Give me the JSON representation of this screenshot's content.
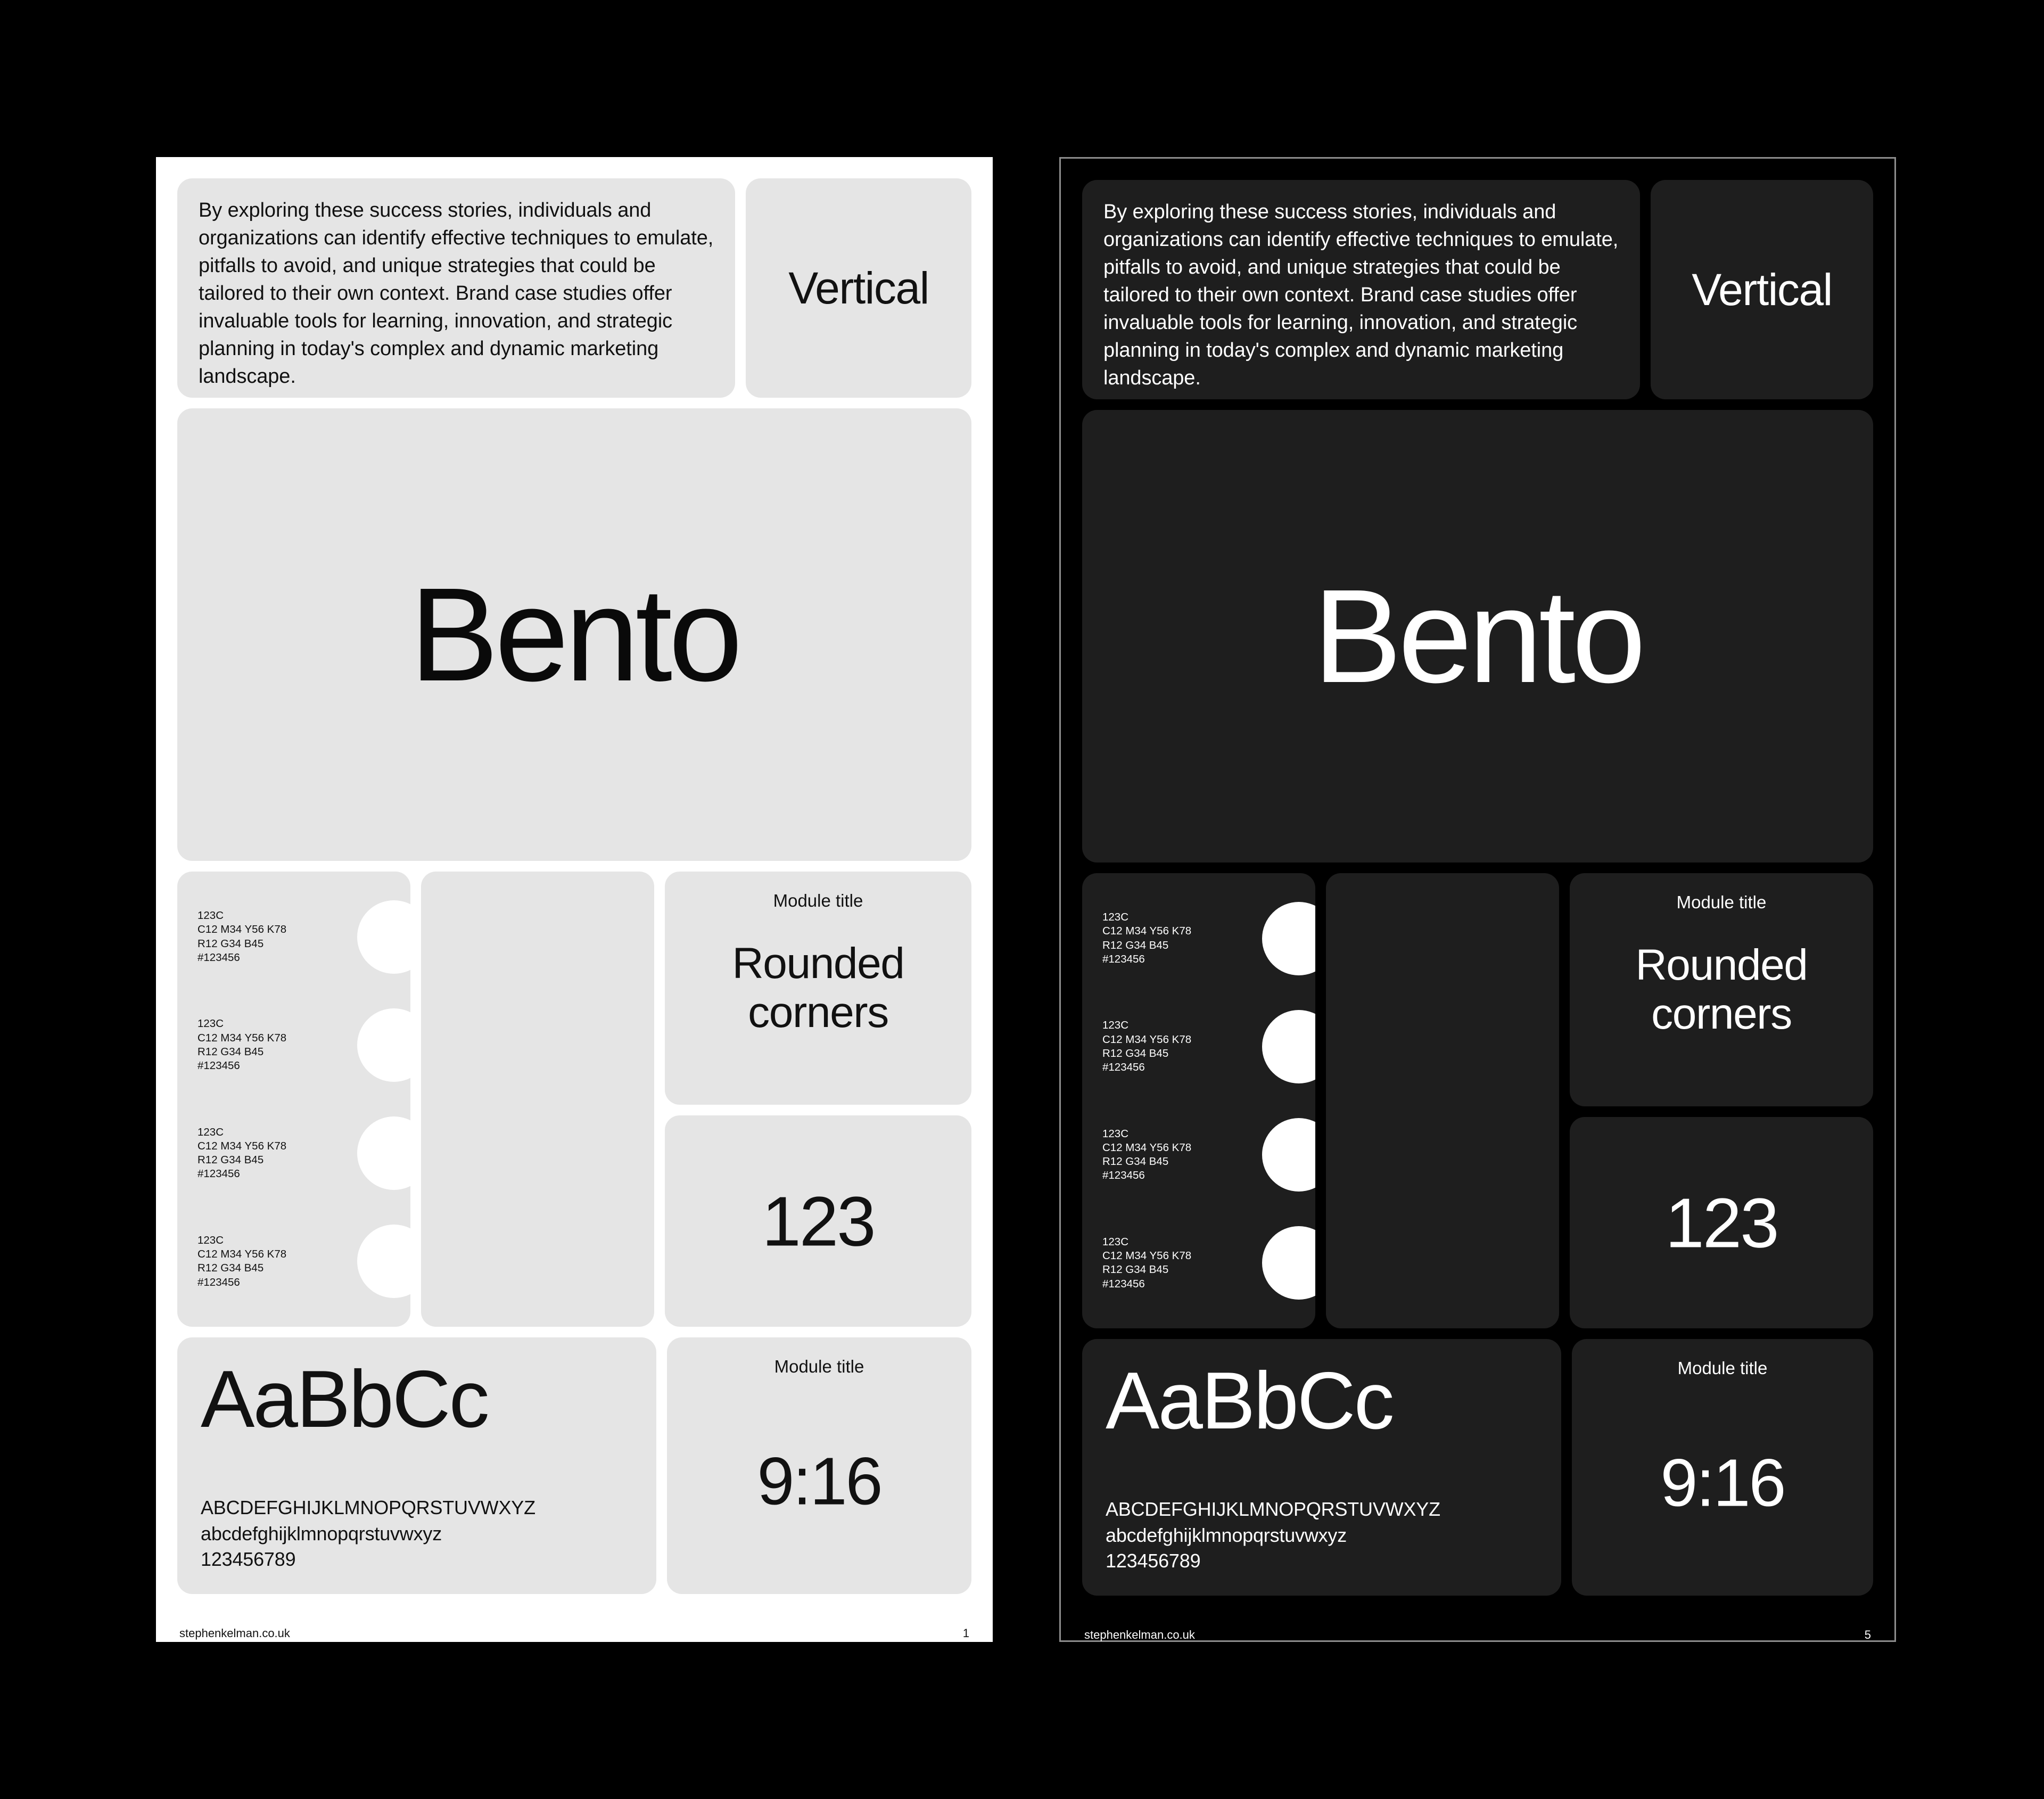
{
  "theme": {
    "canvas_background": "#000000",
    "light_poster_background": "#ffffff",
    "dark_poster_background": "#000000",
    "light_module_background": "#e5e5e5",
    "dark_module_background": "#1e1e1e",
    "light_text": "#111111",
    "dark_text": "#ffffff",
    "dark_poster_border": "#8d8d8d",
    "swatch_dot_color": "#ffffff"
  },
  "content": {
    "body_copy": "By exploring these success stories, individuals and organizations can identify effective techniques to emulate, pitfalls to avoid, and unique strategies that could be tailored to their own context. Brand case studies offer invaluable tools for learning, innovation, and strategic planning in today's complex and dynamic marketing landscape.",
    "vertical_label": "Vertical",
    "hero_word": "Bento",
    "rounded_module": {
      "title": "Module title",
      "headline": "Rounded corners"
    },
    "number_module": {
      "value": "123"
    },
    "ratio_module": {
      "title": "Module title",
      "value": "9:16"
    },
    "typography": {
      "specimen": "AaBbCc",
      "uppercase": "ABCDEFGHIJKLMNOPQRSTUVWXYZ",
      "lowercase": "abcdefghijklmnopqrstuvwxyz",
      "numerals": "123456789"
    },
    "swatches": [
      {
        "pantone": "123C",
        "cmyk": "C12 M34 Y56 K78",
        "rgb": "R12 G34 B45",
        "hex": "#123456"
      },
      {
        "pantone": "123C",
        "cmyk": "C12 M34 Y56 K78",
        "rgb": "R12 G34 B45",
        "hex": "#123456"
      },
      {
        "pantone": "123C",
        "cmyk": "C12 M34 Y56 K78",
        "rgb": "R12 G34 B45",
        "hex": "#123456"
      },
      {
        "pantone": "123C",
        "cmyk": "C12 M34 Y56 K78",
        "rgb": "R12 G34 B45",
        "hex": "#123456"
      }
    ]
  },
  "posters": {
    "light": {
      "footer_url": "stephenkelman.co.uk",
      "page_number": "1"
    },
    "dark": {
      "footer_url": "stephenkelman.co.uk",
      "page_number": "5"
    }
  }
}
